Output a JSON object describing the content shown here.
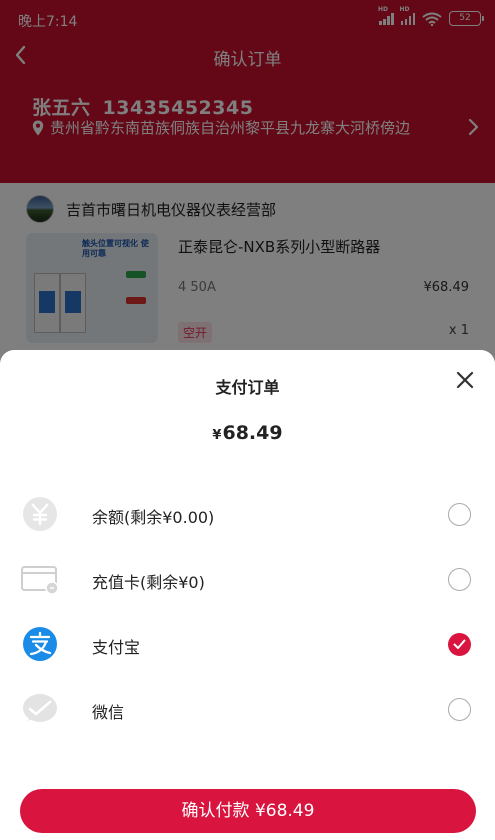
{
  "status_bar": {
    "time": "晚上7:14",
    "battery": "52"
  },
  "header": {
    "title": "确认订单"
  },
  "address": {
    "name": "张五六",
    "phone": "13435452345",
    "full_address": "贵州省黔东南苗族侗族自治州黎平县九龙寨大河桥傍边"
  },
  "shop": {
    "name": "吉首市曙日机电仪器仪表经营部"
  },
  "product": {
    "title": "正泰昆仑-NXB系列小型断路器",
    "spec": "4 50A",
    "price": "¥68.49",
    "badge": "空开",
    "quantity": "x 1",
    "image_heading": "触头位置可视化 使用可靠"
  },
  "payment_sheet": {
    "title": "支付订单",
    "amount_currency": "¥",
    "amount_value": "68.49",
    "options": [
      {
        "label": "余额(剩余¥0.00)",
        "icon": "balance-yuan-icon",
        "selected": false
      },
      {
        "label": "充值卡(剩余¥0)",
        "icon": "prepaid-card-icon",
        "selected": false
      },
      {
        "label": "支付宝",
        "icon": "alipay-icon",
        "selected": true
      },
      {
        "label": "微信",
        "icon": "wechat-icon",
        "selected": false
      }
    ],
    "confirm_label": "确认付款 ¥68.49",
    "accent_color": "#d9153f",
    "alipay_color": "#1a8ce8"
  }
}
